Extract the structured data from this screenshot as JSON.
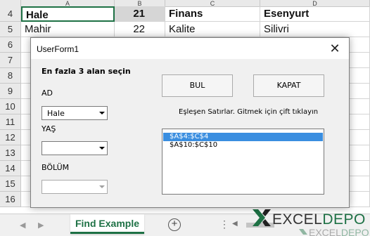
{
  "sheet": {
    "columns": [
      "A",
      "B",
      "C",
      "D"
    ],
    "rows": [
      {
        "num": "4",
        "a": "Hale",
        "b": "21",
        "c": "Finans",
        "d": "Esenyurt",
        "bold": true
      },
      {
        "num": "5",
        "a": "Mahir",
        "b": "22",
        "c": "Kalite",
        "d": "Silivri",
        "bold": false
      },
      {
        "num": "6",
        "a": "",
        "b": "",
        "c": "",
        "d": ""
      },
      {
        "num": "7",
        "a": "",
        "b": "",
        "c": "",
        "d": ""
      },
      {
        "num": "8",
        "a": "",
        "b": "",
        "c": "",
        "d": ""
      },
      {
        "num": "9",
        "a": "",
        "b": "",
        "c": "",
        "d": ""
      },
      {
        "num": "10",
        "a": "",
        "b": "",
        "c": "",
        "d": ""
      },
      {
        "num": "11",
        "a": "",
        "b": "",
        "c": "",
        "d": ""
      },
      {
        "num": "12",
        "a": "",
        "b": "",
        "c": "",
        "d": ""
      },
      {
        "num": "13",
        "a": "",
        "b": "",
        "c": "",
        "d": ""
      },
      {
        "num": "14",
        "a": "",
        "b": "",
        "c": "",
        "d": ""
      },
      {
        "num": "15",
        "a": "",
        "b": "",
        "c": "",
        "d": ""
      },
      {
        "num": "16",
        "a": "",
        "b": "",
        "c": "",
        "d": ""
      }
    ],
    "tab_label": "Find Example",
    "add_sheet_symbol": "+",
    "more_symbol": "⋮"
  },
  "dialog": {
    "title": "UserForm1",
    "close_symbol": "✕",
    "heading": "En fazla 3 alan seçin",
    "field1_label": "AD",
    "field1_value": "Hale",
    "field2_label": "YAŞ",
    "field2_value": "",
    "field3_label": "BÖLÜM",
    "field3_value": "",
    "find_button": "BUL",
    "close_button": "KAPAT",
    "list_caption": "Eşleşen Satırlar. Gitmek için çift tıklayın",
    "results": [
      "$A$4:$C$4",
      "$A$10:$C$10"
    ],
    "selected_result": "$A$4:$C$4"
  },
  "logo": {
    "text": "EXCELDEPO",
    "color": "#1e7145"
  }
}
